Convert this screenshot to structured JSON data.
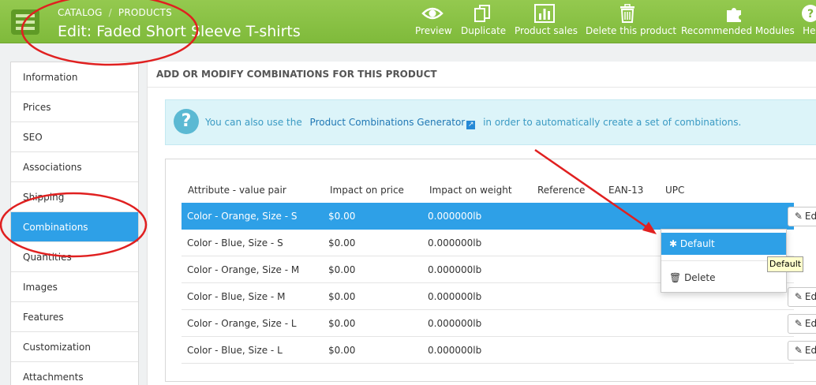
{
  "header": {
    "breadcrumb": [
      "CATALOG",
      "PRODUCTS"
    ],
    "title": "Edit: Faded Short Sleeve T-shirts",
    "toolbar": [
      {
        "label": "Preview",
        "icon": "eye-icon"
      },
      {
        "label": "Duplicate",
        "icon": "copy-icon"
      },
      {
        "label": "Product sales",
        "icon": "bar-chart-icon"
      },
      {
        "label": "Delete this product",
        "icon": "trash-icon"
      },
      {
        "label": "Recommended Modules",
        "icon": "puzzle-icon"
      },
      {
        "label": "Hel",
        "icon": "help-icon"
      }
    ]
  },
  "sidebar": {
    "items": [
      "Information",
      "Prices",
      "SEO",
      "Associations",
      "Shipping",
      "Combinations",
      "Quantities",
      "Images",
      "Features",
      "Customization",
      "Attachments"
    ],
    "active": "Combinations"
  },
  "panel": {
    "heading": "ADD OR MODIFY COMBINATIONS FOR THIS PRODUCT",
    "info": {
      "before": "You can also use the",
      "link": "Product Combinations Generator",
      "after": "in order to automatically create a set of combinations."
    },
    "columns": [
      "Attribute - value pair",
      "Impact on price",
      "Impact on weight",
      "Reference",
      "EAN-13",
      "UPC"
    ],
    "rows": [
      {
        "attr": "Color - Orange, Size - S",
        "price": "$0.00",
        "weight": "0.000000lb",
        "selected": true
      },
      {
        "attr": "Color - Blue, Size - S",
        "price": "$0.00",
        "weight": "0.000000lb"
      },
      {
        "attr": "Color - Orange, Size - M",
        "price": "$0.00",
        "weight": "0.000000lb"
      },
      {
        "attr": "Color - Blue, Size - M",
        "price": "$0.00",
        "weight": "0.000000lb"
      },
      {
        "attr": "Color - Orange, Size - L",
        "price": "$0.00",
        "weight": "0.000000lb"
      },
      {
        "attr": "Color - Blue, Size - L",
        "price": "$0.00",
        "weight": "0.000000lb"
      }
    ],
    "edit_label": "Edit"
  },
  "dropdown": {
    "default_label": "Default",
    "delete_label": "Delete",
    "tooltip": "Default"
  },
  "colors": {
    "header_green": "#8bc34a",
    "accent_blue": "#2ea0e7",
    "annotation_red": "#e02020"
  }
}
